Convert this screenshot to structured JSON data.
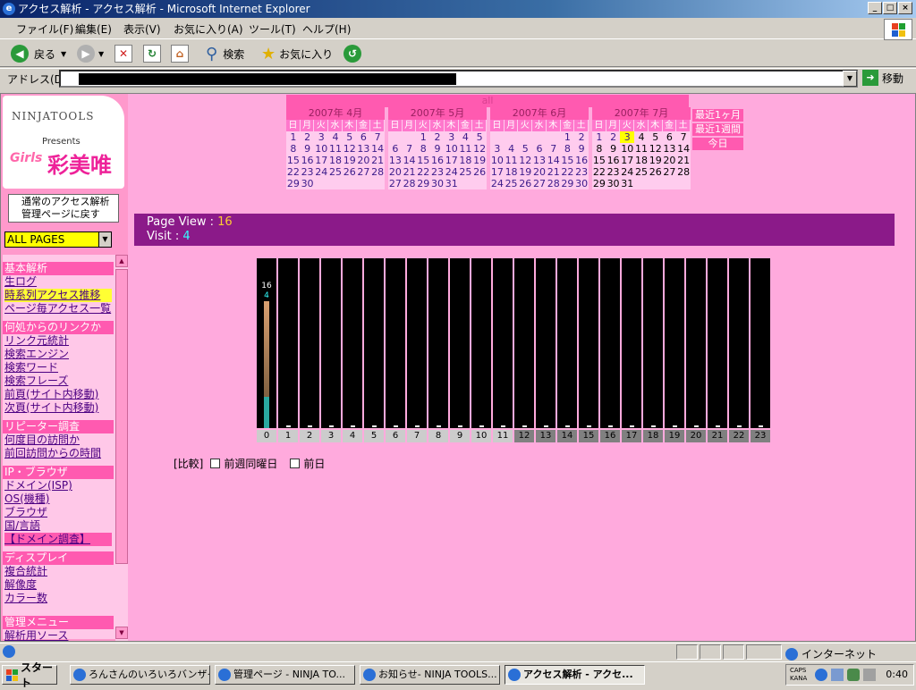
{
  "window": {
    "title": "アクセス解析 - アクセス解析 - Microsoft Internet Explorer"
  },
  "menu": [
    "ファイル(F)",
    "編集(E)",
    "表示(V)",
    "お気に入り(A)",
    "ツール(T)",
    "ヘルプ(H)"
  ],
  "toolbar": {
    "back": "戻る",
    "search": "検索",
    "favorites": "お気に入り"
  },
  "address": {
    "label": "アドレス(D)",
    "go": "移動"
  },
  "sidebar": {
    "logo_title": "NINJATOOLS",
    "logo_presents": "Presents",
    "logo_brand": "Girls",
    "logo_kanji": "彩美唯",
    "back_button_line1": "通常のアクセス解析",
    "back_button_line2": "管理ページに戻す",
    "page_select": "ALL PAGES",
    "sections": [
      {
        "header": "基本解析",
        "links": [
          "生ログ",
          "時系列アクセス推移",
          "ページ毎アクセス一覧"
        ]
      },
      {
        "header": "何処からのリンクか",
        "links": [
          "リンク元統計",
          "検索エンジン",
          "検索ワード",
          "検索フレーズ",
          "前頁(サイト内移動)",
          "次頁(サイト内移動)"
        ]
      },
      {
        "header": "リピーター調査",
        "links": [
          "何度目の訪問か",
          "前回訪問からの時間"
        ]
      },
      {
        "header": "IP・ブラウザ",
        "links": [
          "ドメイン(ISP)",
          "OS(機種)",
          "ブラウザ",
          "国/言語",
          "【ドメイン調査】"
        ]
      },
      {
        "header": "ディスプレイ",
        "links": [
          "複合統計",
          "解像度",
          "カラー数"
        ]
      },
      {
        "header": "管理メニュー",
        "links": [
          "解析用ソース"
        ]
      }
    ]
  },
  "calendar": {
    "all_label": "all",
    "weekdays": [
      "日",
      "月",
      "火",
      "水",
      "木",
      "金",
      "土"
    ],
    "months": [
      {
        "title": "2007年 4月",
        "offset": 0,
        "days": 30,
        "future_from": 99
      },
      {
        "title": "2007年 5月",
        "offset": 2,
        "days": 31,
        "future_from": 99
      },
      {
        "title": "2007年 6月",
        "offset": 5,
        "days": 30,
        "future_from": 99
      },
      {
        "title": "2007年 7月",
        "offset": 0,
        "days": 31,
        "today": 3,
        "future_from": 4
      }
    ],
    "quick": [
      "最近1ヶ月",
      "最近1週間",
      "今日"
    ]
  },
  "stats": {
    "pv_label": "Page View : ",
    "pv_value": "16",
    "visit_label": "Visit : ",
    "visit_value": "4"
  },
  "chart_data": {
    "type": "bar",
    "categories": [
      "0",
      "1",
      "2",
      "3",
      "4",
      "5",
      "6",
      "7",
      "8",
      "9",
      "10",
      "11",
      "12",
      "13",
      "14",
      "15",
      "16",
      "17",
      "18",
      "19",
      "20",
      "21",
      "22",
      "23"
    ],
    "series": [
      {
        "name": "Page View",
        "values": [
          16,
          0,
          0,
          0,
          0,
          0,
          0,
          0,
          0,
          0,
          0,
          0,
          0,
          0,
          0,
          0,
          0,
          0,
          0,
          0,
          0,
          0,
          0,
          0
        ]
      },
      {
        "name": "Visit",
        "values": [
          4,
          0,
          0,
          0,
          0,
          0,
          0,
          0,
          0,
          0,
          0,
          0,
          0,
          0,
          0,
          0,
          0,
          0,
          0,
          0,
          0,
          0,
          0,
          0
        ]
      }
    ],
    "night_hours": [
      12,
      13,
      14,
      15,
      16,
      17,
      18,
      19,
      20,
      21,
      22,
      23
    ],
    "colors": {
      "pageview": "#d9a070",
      "visit": "#2aa8a0",
      "pv_text": "#ffffff",
      "visit_text": "#33ffff"
    }
  },
  "compare": {
    "label": "[比較]",
    "opt1": "前週同曜日",
    "opt2": "前日"
  },
  "status": {
    "zone": "インターネット"
  },
  "taskbar": {
    "start": "スタート",
    "tasks": [
      "ろんさんのいろいろバンザイ...",
      "管理ページ - NINJA TO...",
      "お知らせ- NINJA TOOLS...",
      "アクセス解析 - アクセ..."
    ],
    "clock": "0:40"
  }
}
